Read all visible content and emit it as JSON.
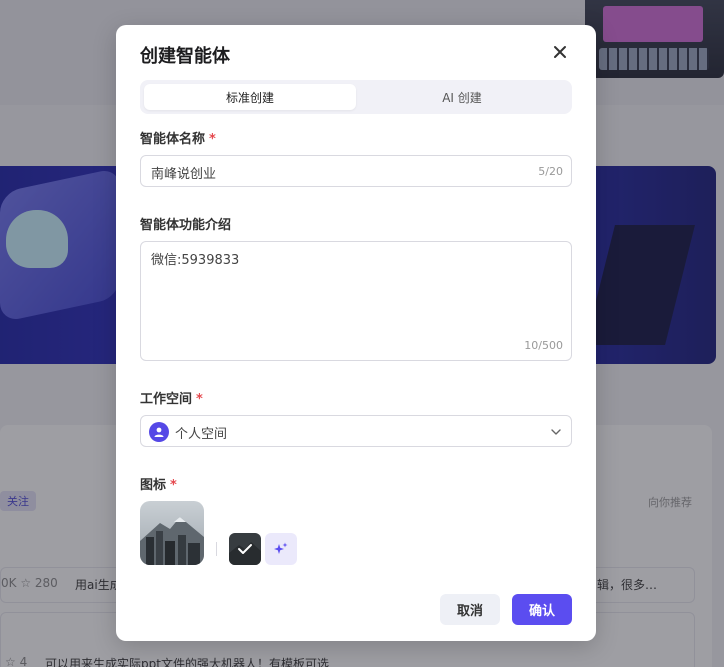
{
  "background": {
    "follow_badge": "关注",
    "recommend_label": "向你推荐",
    "row1_meta": "0K ☆ 280",
    "row1_text": "用ai生成",
    "row1_tail": "辑，很多…",
    "row2_meta": "☆ 4",
    "row2_text": "可以用来生成实际ppt文件的强大机器人！有模板可选"
  },
  "modal": {
    "title": "创建智能体",
    "tabs": [
      {
        "label": "标准创建",
        "active": true
      },
      {
        "label": "AI 创建",
        "active": false
      }
    ],
    "name_field": {
      "label": "智能体名称",
      "required_mark": "*",
      "value": "南峰说创业",
      "counter": "5/20"
    },
    "description_field": {
      "label": "智能体功能介绍",
      "value": "微信:5939833",
      "counter": "10/500"
    },
    "workspace_field": {
      "label": "工作空间",
      "required_mark": "*",
      "value": "个人空间"
    },
    "icon_field": {
      "label": "图标",
      "required_mark": "*"
    },
    "buttons": {
      "cancel": "取消",
      "confirm": "确认"
    }
  },
  "colors": {
    "accent": "#5b4df0",
    "required": "#e5484d"
  },
  "icons": {
    "close": "close-icon",
    "avatar": "user-icon",
    "dropdown": "chevron-down-icon",
    "ai_generate": "sparkle-icon",
    "selected_check": "check-icon"
  }
}
